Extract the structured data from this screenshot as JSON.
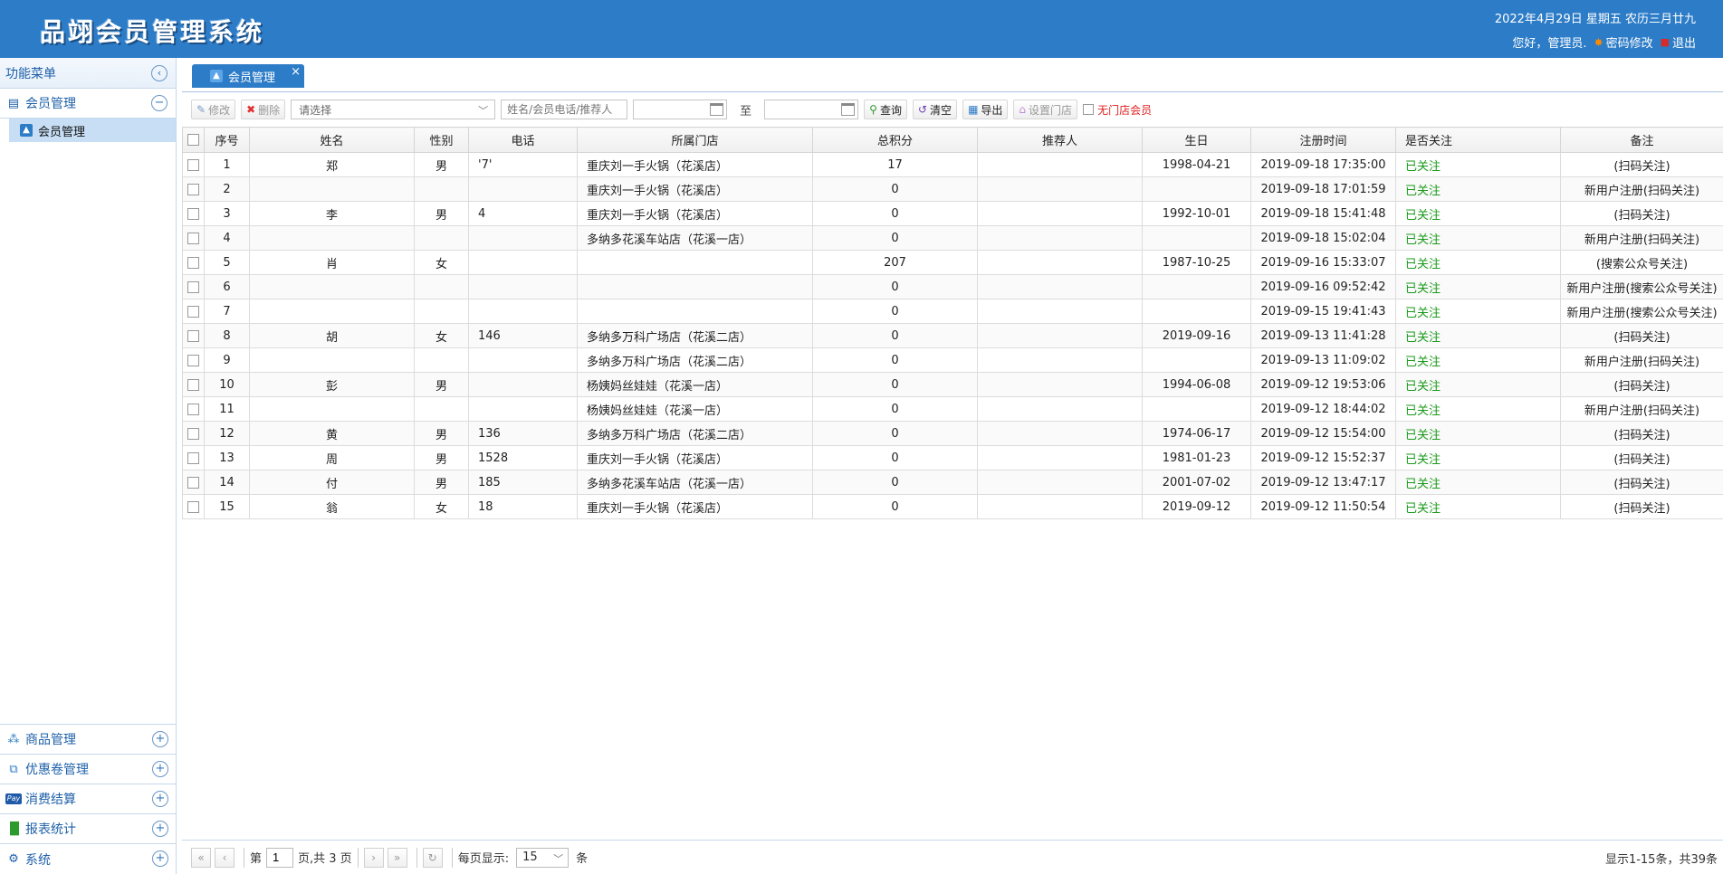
{
  "header": {
    "title": "品翊会员管理系统",
    "date": "2022年4月29日 星期五 农历三月廿九",
    "greeting": "您好，管理员.",
    "change_password": "密码修改",
    "logout": "退出"
  },
  "sidebar": {
    "title": "功能菜单",
    "active_group": "会员管理",
    "active_sub": "会员管理",
    "groups": [
      {
        "label": "商品管理",
        "icon": "goods-icon"
      },
      {
        "label": "优惠卷管理",
        "icon": "coupon-icon"
      },
      {
        "label": "消费结算",
        "icon": "paypal-icon"
      },
      {
        "label": "报表统计",
        "icon": "chart-icon"
      },
      {
        "label": "系统",
        "icon": "gear-icon"
      }
    ]
  },
  "tab": {
    "label": "会员管理"
  },
  "toolbar": {
    "edit": "修改",
    "delete": "删除",
    "store_placeholder": "请选择",
    "search_placeholder": "姓名/会员电话/推荐人",
    "to": "至",
    "query": "查询",
    "clear": "清空",
    "export": "导出",
    "set_store": "设置门店",
    "no_store": "无门店会员"
  },
  "table": {
    "headers": [
      "序号",
      "姓名",
      "性别",
      "电话",
      "所属门店",
      "总积分",
      "推荐人",
      "生日",
      "注册时间",
      "是否关注",
      "备注"
    ],
    "rows": [
      [
        "1",
        "郑",
        "男",
        "'7'",
        "重庆刘一手火锅（花溪店）",
        "17",
        "",
        "1998-04-21",
        "2019-09-18 17:35:00",
        "已关注",
        "(扫码关注)"
      ],
      [
        "2",
        "",
        "",
        "",
        "重庆刘一手火锅（花溪店）",
        "0",
        "",
        "",
        "2019-09-18 17:01:59",
        "已关注",
        "新用户注册(扫码关注)"
      ],
      [
        "3",
        "李",
        "男",
        "4",
        "重庆刘一手火锅（花溪店）",
        "0",
        "",
        "1992-10-01",
        "2019-09-18 15:41:48",
        "已关注",
        "(扫码关注)"
      ],
      [
        "4",
        "",
        "",
        "",
        "多纳多花溪车站店（花溪一店）",
        "0",
        "",
        "",
        "2019-09-18 15:02:04",
        "已关注",
        "新用户注册(扫码关注)"
      ],
      [
        "5",
        "肖",
        "女",
        "",
        "",
        "207",
        "",
        "1987-10-25",
        "2019-09-16 15:33:07",
        "已关注",
        "(搜索公众号关注)"
      ],
      [
        "6",
        "",
        "",
        "",
        "",
        "0",
        "",
        "",
        "2019-09-16 09:52:42",
        "已关注",
        "新用户注册(搜索公众号关注)"
      ],
      [
        "7",
        "",
        "",
        "",
        "",
        "0",
        "",
        "",
        "2019-09-15 19:41:43",
        "已关注",
        "新用户注册(搜索公众号关注)"
      ],
      [
        "8",
        "胡",
        "女",
        "146",
        "多纳多万科广场店（花溪二店）",
        "0",
        "",
        "2019-09-16",
        "2019-09-13 11:41:28",
        "已关注",
        "(扫码关注)"
      ],
      [
        "9",
        "",
        "",
        "",
        "多纳多万科广场店（花溪二店）",
        "0",
        "",
        "",
        "2019-09-13 11:09:02",
        "已关注",
        "新用户注册(扫码关注)"
      ],
      [
        "10",
        "彭",
        "男",
        "",
        "杨姨妈丝娃娃（花溪一店）",
        "0",
        "",
        "1994-06-08",
        "2019-09-12 19:53:06",
        "已关注",
        "(扫码关注)"
      ],
      [
        "11",
        "",
        "",
        "",
        "杨姨妈丝娃娃（花溪一店）",
        "0",
        "",
        "",
        "2019-09-12 18:44:02",
        "已关注",
        "新用户注册(扫码关注)"
      ],
      [
        "12",
        "黄",
        "男",
        "136",
        "多纳多万科广场店（花溪二店）",
        "0",
        "",
        "1974-06-17",
        "2019-09-12 15:54:00",
        "已关注",
        "(扫码关注)"
      ],
      [
        "13",
        "周",
        "男",
        "1528",
        "重庆刘一手火锅（花溪店）",
        "0",
        "",
        "1981-01-23",
        "2019-09-12 15:52:37",
        "已关注",
        "(扫码关注)"
      ],
      [
        "14",
        "付",
        "男",
        "185",
        "多纳多花溪车站店（花溪一店）",
        "0",
        "",
        "2001-07-02",
        "2019-09-12 13:47:17",
        "已关注",
        "(扫码关注)"
      ],
      [
        "15",
        "翁",
        "女",
        "18",
        "重庆刘一手火锅（花溪店）",
        "0",
        "",
        "2019-09-12",
        "2019-09-12 11:50:54",
        "已关注",
        "(扫码关注)"
      ]
    ]
  },
  "pager": {
    "page_prefix": "第",
    "page": "1",
    "page_suffix": "页,共 3 页",
    "per_page_label": "每页显示:",
    "per_page": "15",
    "per_page_unit": "条",
    "info": "显示1-15条，共39条"
  }
}
